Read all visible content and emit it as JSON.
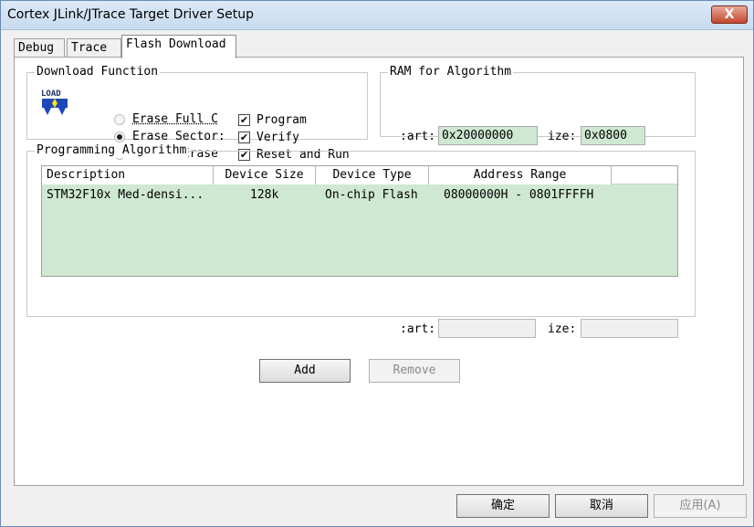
{
  "window": {
    "title": "Cortex JLink/JTrace Target Driver Setup",
    "close_glyph": "X"
  },
  "tabs": [
    {
      "label": "Debug"
    },
    {
      "label": "Trace"
    },
    {
      "label": "Flash Download"
    }
  ],
  "download_function": {
    "title": "Download Function",
    "icon_text": "LOAD",
    "radios": [
      {
        "label": "Erase Full C",
        "checked": false
      },
      {
        "label": "Erase Sector:",
        "checked": true
      },
      {
        "label": "Do not Erase",
        "checked": false
      }
    ],
    "checkboxes": [
      {
        "label": "Program",
        "checked": true
      },
      {
        "label": "Verify",
        "checked": true
      },
      {
        "label": "Reset and Run",
        "checked": true
      }
    ],
    "check_glyph": "✔"
  },
  "ram": {
    "title": "RAM for Algorithm",
    "start_label": ":art:",
    "start_value": "0x20000000",
    "size_label": "ize:",
    "size_value": "0x0800"
  },
  "programming_algorithm": {
    "title": "Programming Algorithm",
    "columns": [
      "Description",
      "Device Size",
      "Device Type",
      "Address Range"
    ],
    "rows": [
      {
        "description": "STM32F10x Med-densi...",
        "size": "128k",
        "type": "On-chip Flash",
        "range": "08000000H - 0801FFFFH"
      }
    ],
    "start_label": ":art:",
    "start_value": "",
    "size_label": "ize:",
    "size_value": ""
  },
  "buttons": {
    "add": "Add",
    "remove": "Remove",
    "ok": "确定",
    "cancel": "取消",
    "apply": "应用(A)"
  },
  "colors": {
    "field_bg": "#cfe8d2",
    "titlebar": "#dbe9f8"
  }
}
